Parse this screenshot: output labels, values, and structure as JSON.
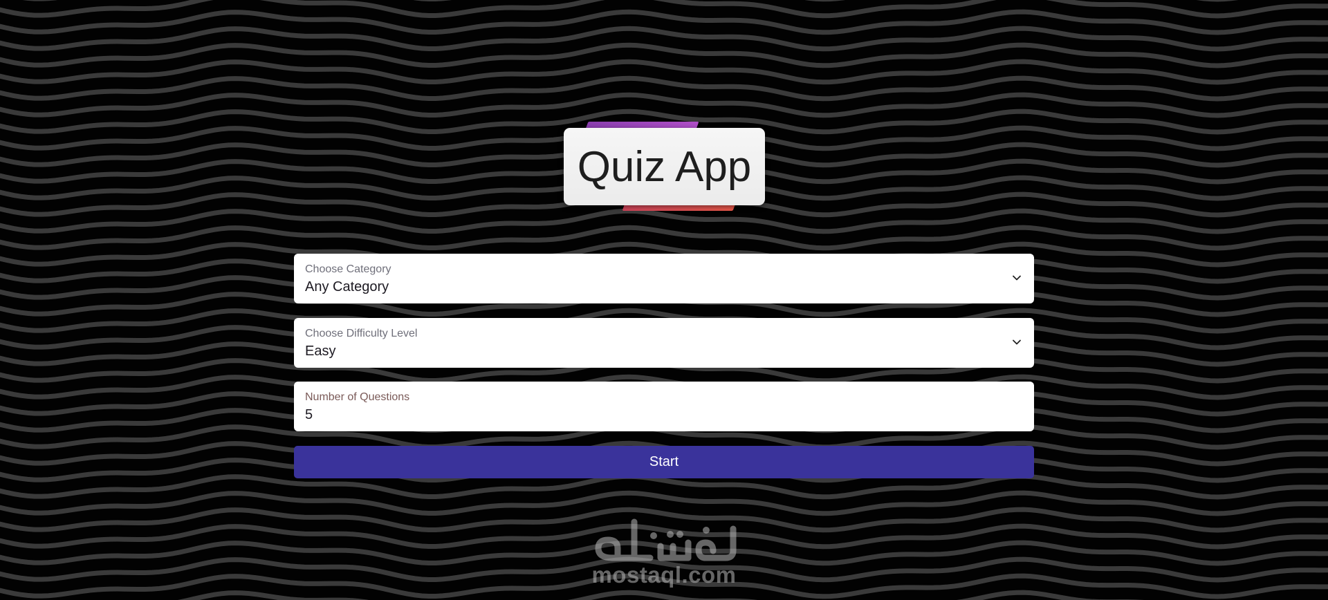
{
  "app": {
    "title": "Quiz App"
  },
  "form": {
    "category": {
      "label": "Choose Category",
      "value": "Any Category"
    },
    "difficulty": {
      "label": "Choose Difficulty Level",
      "value": "Easy"
    },
    "questions": {
      "label": "Number of Questions",
      "value": "5"
    },
    "start_label": "Start"
  },
  "watermark": {
    "text": "mostaql.com",
    "logo_text": "مستقل"
  },
  "icons": {
    "select_arrow": "chevron-down-icon"
  },
  "colors": {
    "background": "#000000",
    "wave_stroke": "#3a3a3a",
    "primary_button": "#3a339b",
    "title_deco_top": "#9b45bd",
    "title_deco_bottom": "#e0504f",
    "field_background": "#ffffff"
  }
}
